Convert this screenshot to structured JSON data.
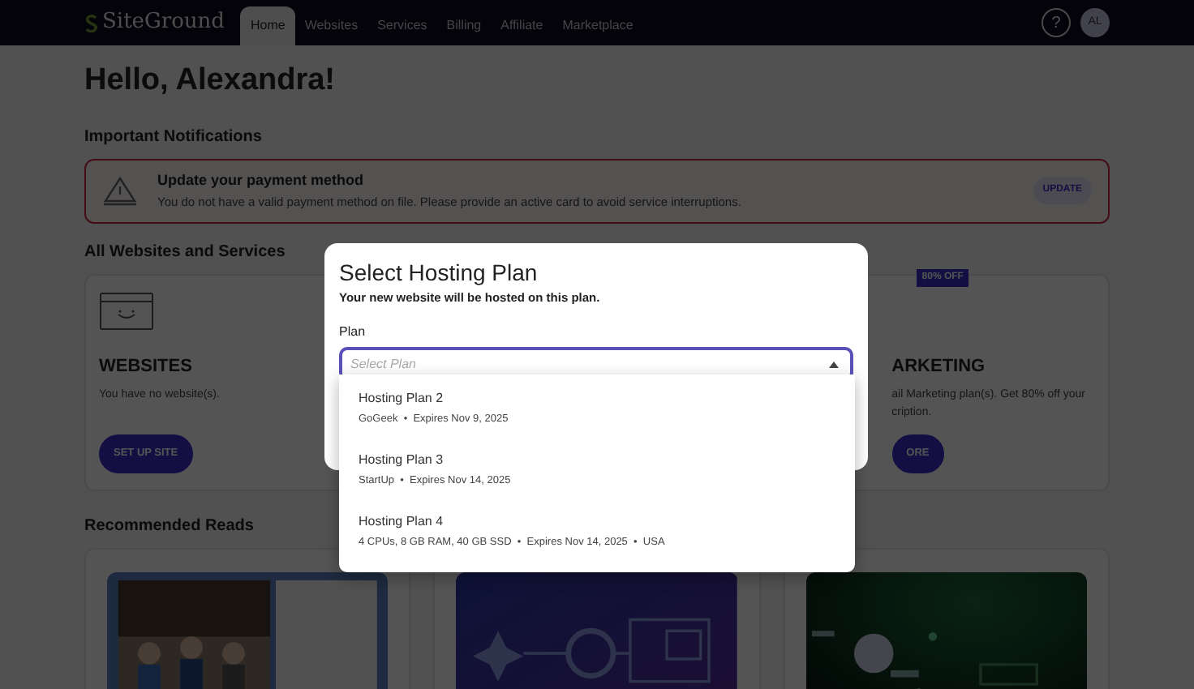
{
  "navbar": {
    "logo": "SiteGround",
    "tabs": [
      {
        "label": "Home",
        "selected": true
      },
      {
        "label": "Websites",
        "selected": false
      },
      {
        "label": "Services",
        "selected": false
      },
      {
        "label": "Billing",
        "selected": false
      },
      {
        "label": "Affiliate",
        "selected": false
      },
      {
        "label": "Marketplace",
        "selected": false
      }
    ],
    "help": "?",
    "avatar": "AL"
  },
  "greeting": "Hello, Alexandra!",
  "notifications": {
    "heading": "Important Notifications",
    "alert": {
      "title": "Update your payment method",
      "message": "You do not have a valid payment method on file. Please provide an active card to avoid service interruptions.",
      "button": "UPDATE"
    }
  },
  "services": {
    "heading": "All Websites and Services",
    "cards": [
      {
        "kind": "websites",
        "title": "WEBSITES",
        "lines": [
          "You have no website(s)."
        ],
        "button": "SET UP SITE"
      },
      {
        "kind": "marketing",
        "badge": "80% OFF",
        "title": "ARKETING",
        "lines": [
          "ail Marketing plan(s). Get 80% off your",
          "cription."
        ],
        "button": "ORE"
      }
    ]
  },
  "reads": {
    "heading": "Recommended Reads"
  },
  "modal": {
    "title": "Select Hosting Plan",
    "subtitle": "Your new website will be hosted on this plan.",
    "field_label": "Plan",
    "placeholder": "Select Plan",
    "expanded": true,
    "options": [
      {
        "name": "Hosting Plan 2",
        "details": "GoGeek  •  Expires Nov 9, 2025"
      },
      {
        "name": "Hosting Plan 3",
        "details": "StartUp  •  Expires Nov 14, 2025"
      },
      {
        "name": "Hosting Plan 4",
        "details": "4 CPUs, 8 GB RAM, 40 GB SSD  •  Expires Nov 14, 2025  •  USA"
      }
    ]
  }
}
